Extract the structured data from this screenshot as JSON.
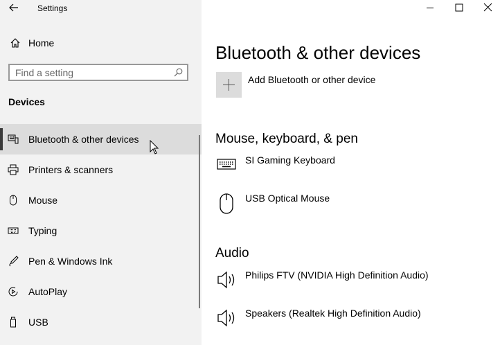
{
  "window": {
    "title": "Settings"
  },
  "sidebar": {
    "home_label": "Home",
    "search_placeholder": "Find a setting",
    "section_title": "Devices",
    "items": [
      {
        "label": "Bluetooth & other devices",
        "icon": "bluetooth-devices-icon",
        "selected": true
      },
      {
        "label": "Printers & scanners",
        "icon": "printer-icon",
        "selected": false
      },
      {
        "label": "Mouse",
        "icon": "mouse-icon",
        "selected": false
      },
      {
        "label": "Typing",
        "icon": "keyboard-icon",
        "selected": false
      },
      {
        "label": "Pen & Windows Ink",
        "icon": "pen-icon",
        "selected": false
      },
      {
        "label": "AutoPlay",
        "icon": "autoplay-icon",
        "selected": false
      },
      {
        "label": "USB",
        "icon": "usb-icon",
        "selected": false
      }
    ]
  },
  "main": {
    "title": "Bluetooth & other devices",
    "add_device_label": "Add Bluetooth or other device",
    "groups": [
      {
        "title": "Mouse, keyboard, & pen",
        "devices": [
          {
            "name": "SI Gaming Keyboard",
            "icon": "keyboard-icon"
          },
          {
            "name": "USB Optical Mouse",
            "icon": "mouse-icon"
          }
        ]
      },
      {
        "title": "Audio",
        "devices": [
          {
            "name": "Philips FTV (NVIDIA High Definition Audio)",
            "icon": "speaker-icon"
          },
          {
            "name": "Speakers (Realtek High Definition Audio)",
            "icon": "speaker-icon"
          }
        ]
      }
    ]
  },
  "colors": {
    "sidebar_bg": "#f2f2f2",
    "selected_bg": "#dcdcdc",
    "add_button_bg": "#dcdcdc"
  }
}
